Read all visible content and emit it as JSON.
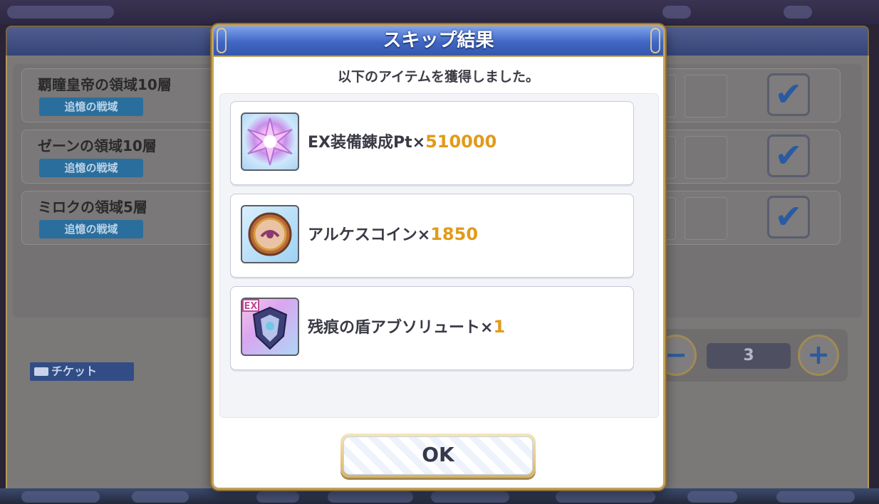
{
  "background": {
    "stages": [
      {
        "title": "覇瞳皇帝の領域10層",
        "tag": "追憶の戦域",
        "checked": true
      },
      {
        "title": "ゼーンの領域10層",
        "tag": "追憶の戦域",
        "checked": true
      },
      {
        "title": "ミロクの領域5層",
        "tag": "追憶の戦域",
        "checked": true
      }
    ],
    "ticket_label": "チケット",
    "quantity": "3"
  },
  "modal": {
    "title": "スキップ結果",
    "subtitle": "以下のアイテムを獲得しました。",
    "items": [
      {
        "name": "EX装備錬成Pt×",
        "qty": "510000",
        "icon": "ex-equipment-refine-pt-icon"
      },
      {
        "name": "アルケスコイン×",
        "qty": "1850",
        "icon": "arkes-coin-icon"
      },
      {
        "name": "残痕の盾アブソリュート×",
        "qty": "1",
        "icon": "ex-shield-absolute-icon",
        "badge": "EX"
      }
    ],
    "ok_label": "OK"
  },
  "colors": {
    "header_blue": "#3f66c2",
    "gold_border": "#c4a25c",
    "qty_orange": "#e29a1a"
  }
}
